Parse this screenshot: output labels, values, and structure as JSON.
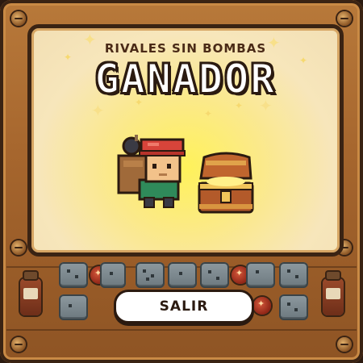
{
  "result": {
    "subtitle": "RIVALES SIN BOMBAS",
    "title": "GANADOR"
  },
  "actions": {
    "exit_label": "SALIR"
  },
  "icons": {
    "character": "bomber-character-icon",
    "reward": "treasure-chest-icon",
    "decor": [
      "bomb-icon",
      "stone-tile-icon",
      "potion-jar-icon",
      "sparkle-icon"
    ]
  },
  "colors": {
    "frame_wood": "#a5652d",
    "frame_outline": "#3a2313",
    "panel_glow": "#fff25a",
    "panel_bg": "#f2dfb4",
    "button_bg": "#ffffff",
    "button_text": "#2b1a10"
  }
}
